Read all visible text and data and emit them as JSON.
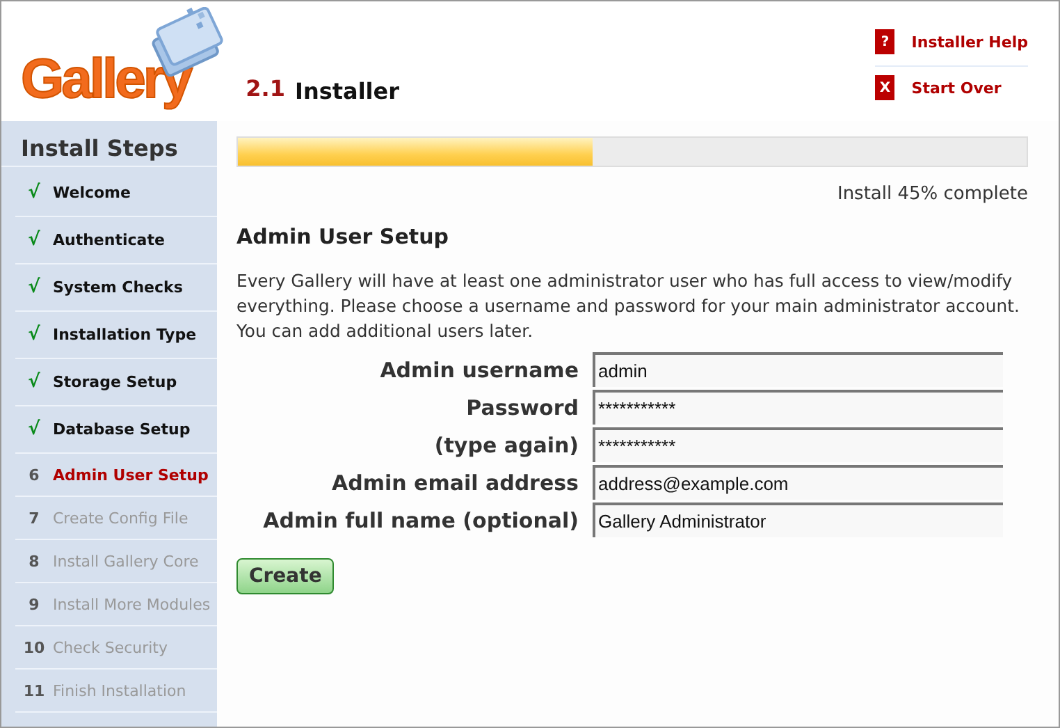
{
  "header": {
    "logo": {
      "name": "Gallery",
      "version": "2.1",
      "title": "Installer"
    },
    "links": [
      {
        "icon": "?",
        "label": "Installer Help"
      },
      {
        "icon": "X",
        "label": "Start Over"
      }
    ]
  },
  "sidebar": {
    "title": "Install Steps",
    "steps": [
      {
        "marker": "√",
        "label": "Welcome",
        "done": true,
        "selected": false
      },
      {
        "marker": "√",
        "label": "Authenticate",
        "done": true,
        "selected": false
      },
      {
        "marker": "√",
        "label": "System Checks",
        "done": true,
        "selected": false
      },
      {
        "marker": "√",
        "label": "Installation Type",
        "done": true,
        "selected": false
      },
      {
        "marker": "√",
        "label": "Storage Setup",
        "done": true,
        "selected": false
      },
      {
        "marker": "√",
        "label": "Database Setup",
        "done": true,
        "selected": false
      },
      {
        "marker": "6",
        "label": "Admin User Setup",
        "done": false,
        "selected": true
      },
      {
        "marker": "7",
        "label": "Create Config File",
        "done": false,
        "selected": false
      },
      {
        "marker": "8",
        "label": "Install Gallery Core",
        "done": false,
        "selected": false
      },
      {
        "marker": "9",
        "label": "Install More Modules",
        "done": false,
        "selected": false
      },
      {
        "marker": "10",
        "label": "Check Security",
        "done": false,
        "selected": false
      },
      {
        "marker": "11",
        "label": "Finish Installation",
        "done": false,
        "selected": false
      }
    ]
  },
  "progress": {
    "level": 0.45,
    "label": "Install 45% complete"
  },
  "heading": "Admin User Setup",
  "intro": "Every Gallery will have at least one administrator user who has full access to view/modify everything. Please choose a username and password for your main administrator account. You can add additional users later.",
  "fields": [
    {
      "label": "Admin username",
      "value": "admin"
    },
    {
      "label": "Password",
      "value": "***********"
    },
    {
      "label": "(type again)",
      "value": "***********"
    },
    {
      "label": "Admin email address",
      "value": "address@example.com"
    },
    {
      "label": "Admin full name (optional)",
      "value": "Gallery Administrator"
    }
  ],
  "button": "Create"
}
